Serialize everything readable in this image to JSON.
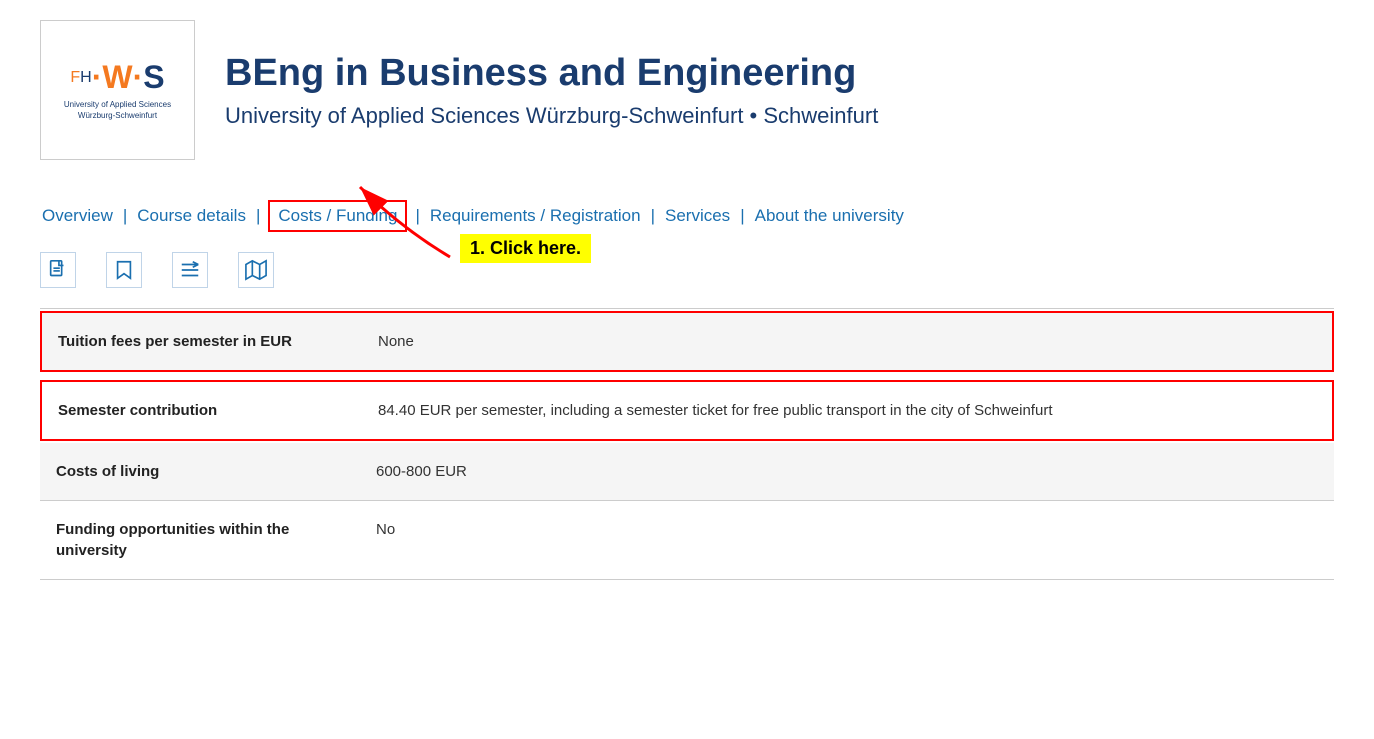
{
  "header": {
    "logo_text": "FH·W·S",
    "logo_subtitle": "University of Applied Sciences\nWürzburg-Schweinfurt",
    "title": "BEng in Business and Engineering",
    "subtitle": "University of Applied Sciences Würzburg-Schweinfurt • Schweinfurt"
  },
  "nav": {
    "items": [
      {
        "id": "overview",
        "label": "Overview",
        "active": false
      },
      {
        "id": "course-details",
        "label": "Course details",
        "active": false
      },
      {
        "id": "costs-funding",
        "label": "Costs / Funding",
        "active": true
      },
      {
        "id": "requirements",
        "label": "Requirements / Registration",
        "active": false
      },
      {
        "id": "services",
        "label": "Services",
        "active": false
      },
      {
        "id": "about",
        "label": "About the university",
        "active": false
      }
    ]
  },
  "annotation": {
    "click_here": "1. Click here."
  },
  "table": {
    "rows": [
      {
        "id": "tuition-fees",
        "label": "Tuition fees per semester in EUR",
        "value": "None",
        "highlighted": true,
        "alt_bg": true
      },
      {
        "id": "semester-contribution",
        "label": "Semester contribution",
        "value": "84.40 EUR per semester, including a semester ticket for free public transport in the city of Schweinfurt",
        "highlighted": true,
        "alt_bg": false
      },
      {
        "id": "costs-living",
        "label": "Costs of living",
        "value": "600-800 EUR",
        "highlighted": false,
        "alt_bg": true
      },
      {
        "id": "funding-opportunities",
        "label": "Funding opportunities within the university",
        "value": "No",
        "highlighted": false,
        "alt_bg": false
      }
    ]
  }
}
